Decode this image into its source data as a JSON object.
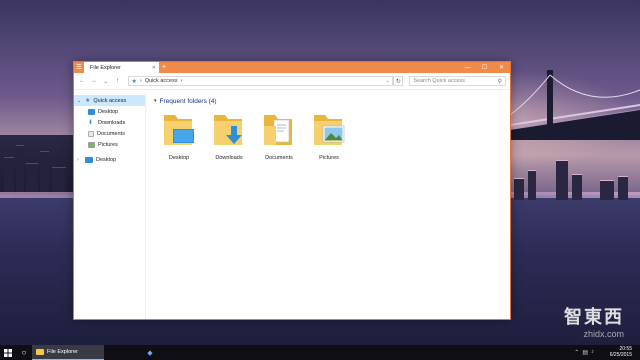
{
  "window": {
    "tab_title": "File Explorer",
    "search_placeholder": "Search Quick access",
    "address": {
      "separator": "›",
      "location": "Quick access"
    }
  },
  "sidebar": {
    "items": [
      {
        "label": "Quick access",
        "icon": "star-icon"
      },
      {
        "label": "Desktop",
        "icon": "desktop-folder-icon"
      },
      {
        "label": "Downloads",
        "icon": "downloads-folder-icon"
      },
      {
        "label": "Documents",
        "icon": "documents-folder-icon"
      },
      {
        "label": "Pictures",
        "icon": "pictures-folder-icon"
      },
      {
        "label": "Desktop",
        "icon": "desktop-icon"
      }
    ]
  },
  "main": {
    "group_title": "Frequent folders (4)",
    "folders": [
      {
        "label": "Desktop",
        "icon": "desktop-folder-icon"
      },
      {
        "label": "Downloads",
        "icon": "downloads-folder-icon"
      },
      {
        "label": "Documents",
        "icon": "documents-folder-icon"
      },
      {
        "label": "Pictures",
        "icon": "pictures-folder-icon"
      }
    ]
  },
  "taskbar": {
    "app_label": "File Explorer",
    "time": "20:55",
    "date": "6/25/2015"
  },
  "watermark": {
    "title": "智東西",
    "subtitle": "zhidx.com"
  },
  "colors": {
    "titlebar": "#f08a4b",
    "accent_blue": "#3f7bd6",
    "folder_yellow": "#f2c94c",
    "selection": "#cce8ff"
  }
}
